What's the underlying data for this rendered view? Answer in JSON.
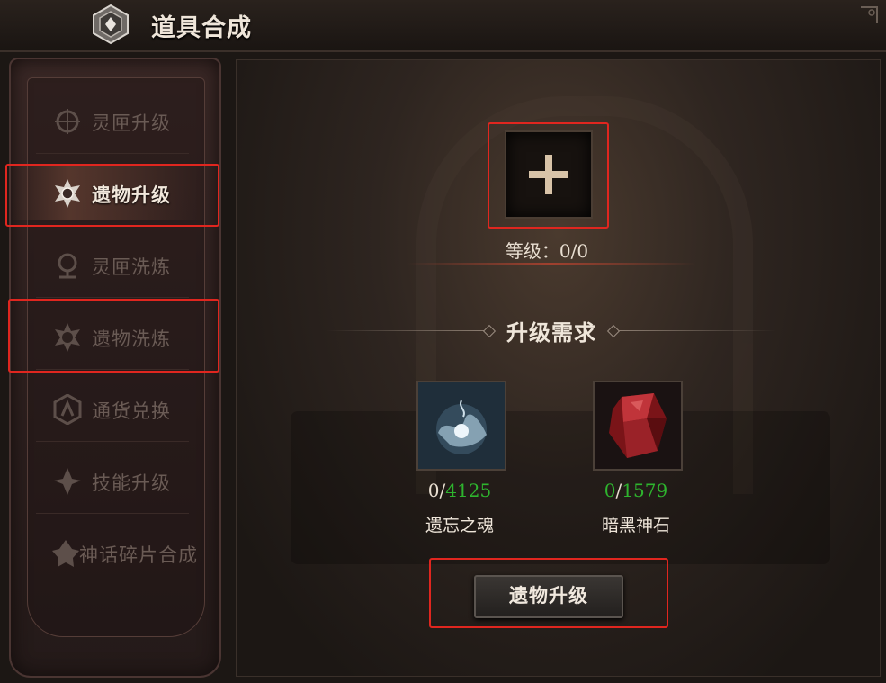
{
  "window": {
    "title": "道具合成"
  },
  "sidebar": {
    "items": [
      {
        "label": "灵匣升级",
        "active": false,
        "icon": "spirit-box-icon"
      },
      {
        "label": "遗物升级",
        "active": true,
        "icon": "relic-icon"
      },
      {
        "label": "灵匣洗炼",
        "active": false,
        "icon": "spirit-box-refine-icon"
      },
      {
        "label": "遗物洗炼",
        "active": false,
        "icon": "relic-refine-icon"
      },
      {
        "label": "通货兑换",
        "active": false,
        "icon": "currency-exchange-icon"
      },
      {
        "label": "技能升级",
        "active": false,
        "icon": "skill-icon"
      },
      {
        "label": "神话碎片合成",
        "active": false,
        "icon": "myth-shard-icon"
      }
    ]
  },
  "main": {
    "slot_icon": "plus-icon",
    "level_text": "等级：0/0",
    "requirements_title": "升级需求",
    "materials": [
      {
        "name": "遗忘之魂",
        "have": "0",
        "need": "4125",
        "icon": "forgotten-soul-icon"
      },
      {
        "name": "暗黑神石",
        "have": "0",
        "need": "1579",
        "icon": "dark-stone-icon"
      }
    ],
    "action_button": "遗物升级"
  },
  "colors": {
    "highlight": "#e0261f",
    "count_ok": "#2eb42e",
    "text_light": "#efe6da",
    "text_dim": "#6a5b55"
  }
}
